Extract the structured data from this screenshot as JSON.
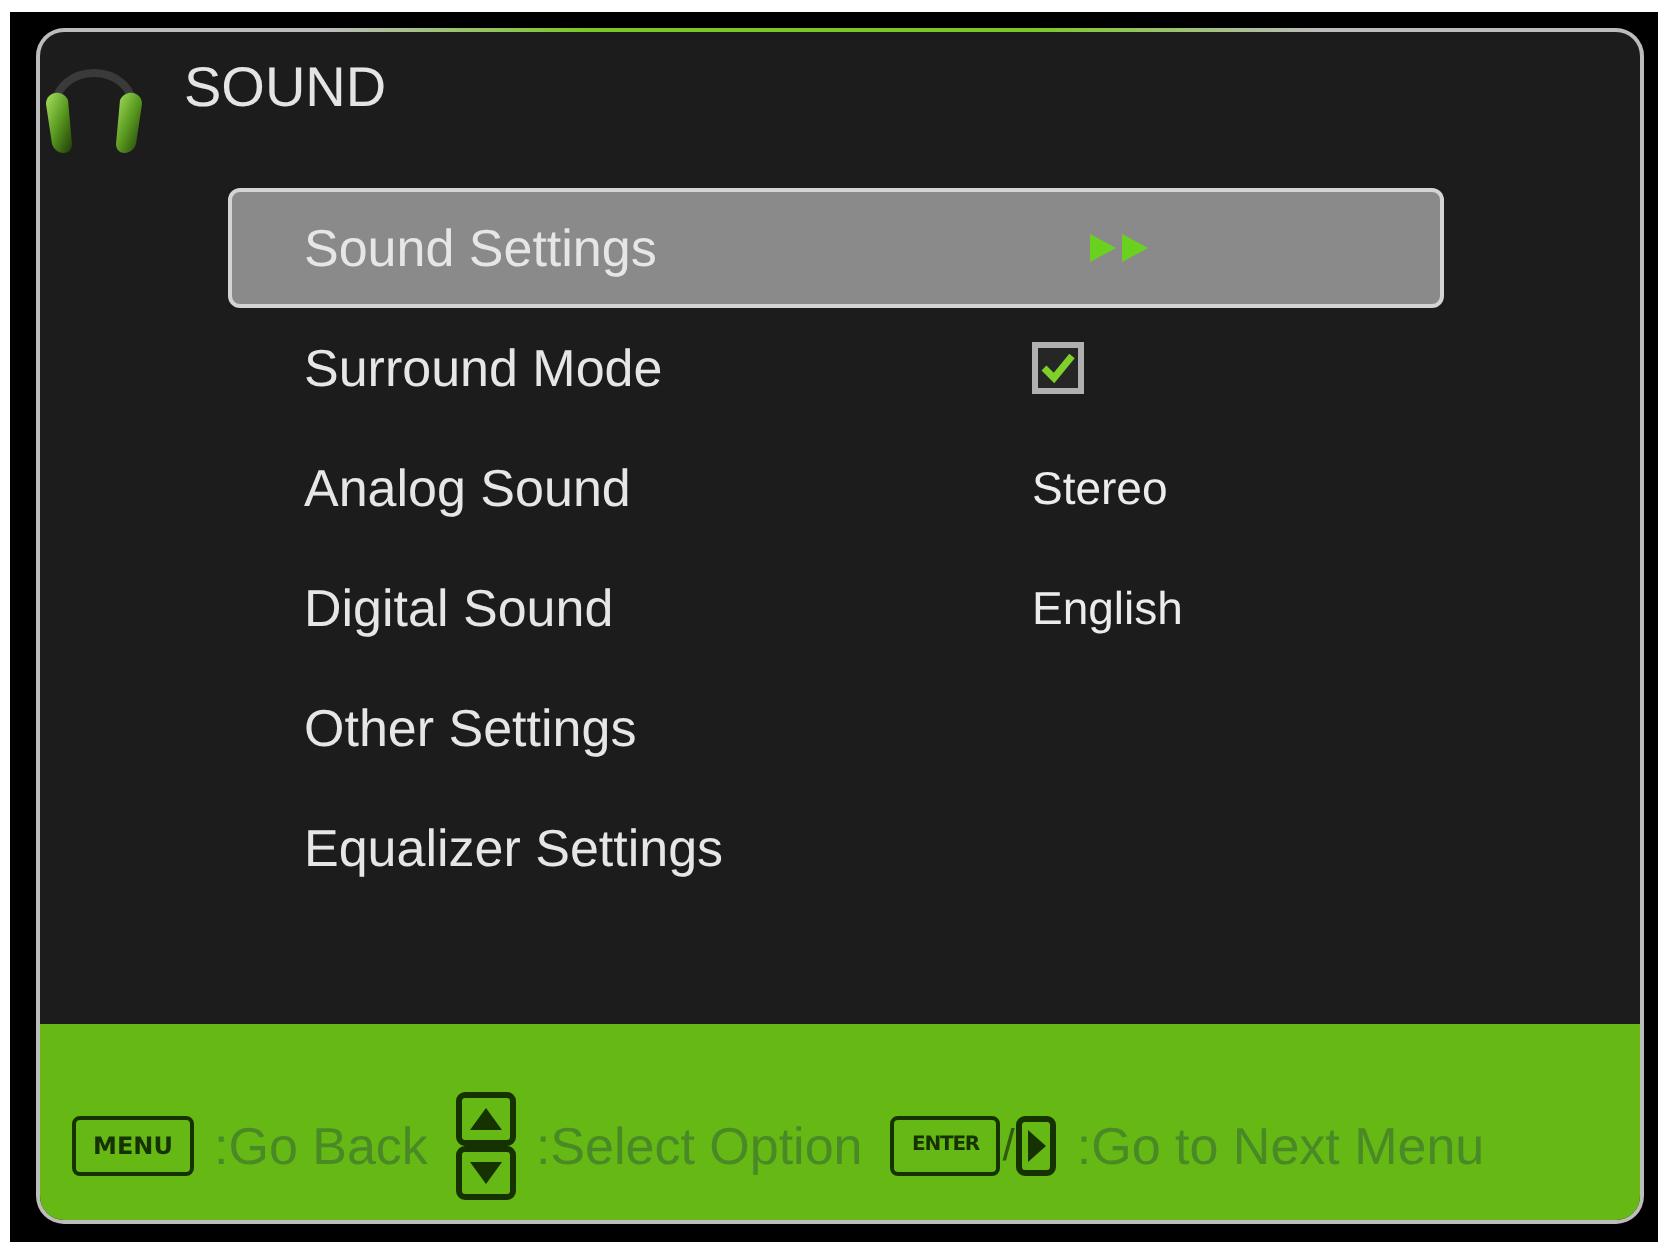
{
  "window": {
    "title": "SOUND"
  },
  "menu": {
    "items": [
      {
        "label": "Sound Settings",
        "kind": "submenu",
        "selected": true
      },
      {
        "label": "Surround Mode",
        "kind": "checkbox",
        "checked": true,
        "selected": false
      },
      {
        "label": "Analog Sound",
        "kind": "option",
        "value": "Stereo",
        "selected": false
      },
      {
        "label": "Digital Sound",
        "kind": "option",
        "value": "English",
        "selected": false
      },
      {
        "label": "Other Settings",
        "kind": "submenu",
        "selected": false
      },
      {
        "label": "Equalizer Settings",
        "kind": "submenu",
        "selected": false
      }
    ]
  },
  "footer": {
    "hints": [
      {
        "keys": [
          {
            "kind": "label",
            "label": "MENU"
          }
        ],
        "text": ":Go Back"
      },
      {
        "keys": [
          {
            "kind": "up_down"
          }
        ],
        "text": ":Select Option"
      },
      {
        "keys": [
          {
            "kind": "label",
            "label": "ENTER"
          },
          {
            "kind": "slash",
            "label": "/"
          },
          {
            "kind": "right"
          }
        ],
        "text": ":Go to Next Menu"
      }
    ]
  }
}
